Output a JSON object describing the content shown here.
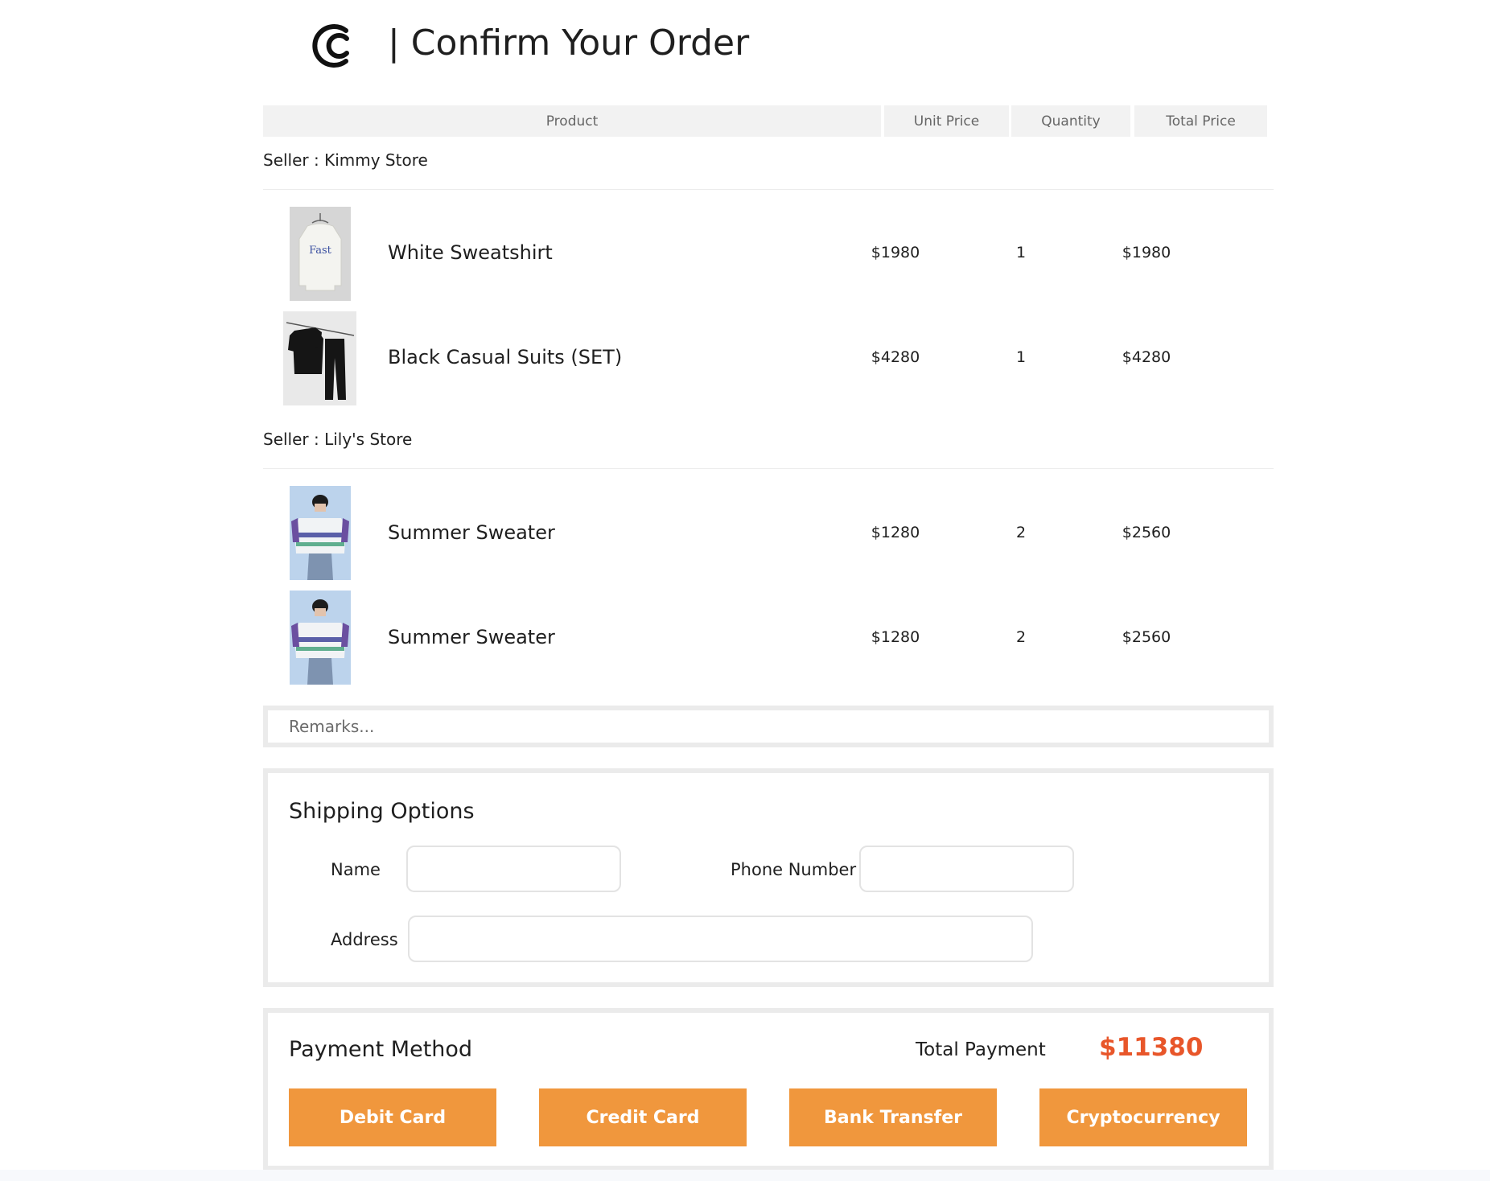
{
  "header": {
    "title": "| Confirm Your Order"
  },
  "table": {
    "columns": {
      "product": "Product",
      "unit_price": "Unit Price",
      "quantity": "Quantity",
      "total_price": "Total Price"
    }
  },
  "sellers": [
    {
      "label": "Seller : Kimmy Store",
      "items": [
        {
          "name": "White Sweatshirt",
          "unit_price": "$1980",
          "quantity": "1",
          "total_price": "$1980"
        },
        {
          "name": "Black Casual Suits (SET)",
          "unit_price": "$4280",
          "quantity": "1",
          "total_price": "$4280"
        }
      ]
    },
    {
      "label": "Seller : Lily's Store",
      "items": [
        {
          "name": "Summer Sweater",
          "unit_price": "$1280",
          "quantity": "2",
          "total_price": "$2560"
        },
        {
          "name": "Summer Sweater",
          "unit_price": "$1280",
          "quantity": "2",
          "total_price": "$2560"
        }
      ]
    }
  ],
  "remarks": {
    "placeholder": "Remarks..."
  },
  "shipping": {
    "title": "Shipping Options",
    "name_label": "Name",
    "phone_label": "Phone Number",
    "address_label": "Address"
  },
  "payment": {
    "title": "Payment Method",
    "total_label": "Total Payment",
    "total_value": "$11380",
    "methods": [
      "Debit Card",
      "Credit Card",
      "Bank Transfer",
      "Cryptocurrency"
    ]
  },
  "colors": {
    "accent": "#f0973d",
    "total": "#e8562a",
    "header_bg": "#f2f2f2",
    "border": "#ebebeb"
  }
}
